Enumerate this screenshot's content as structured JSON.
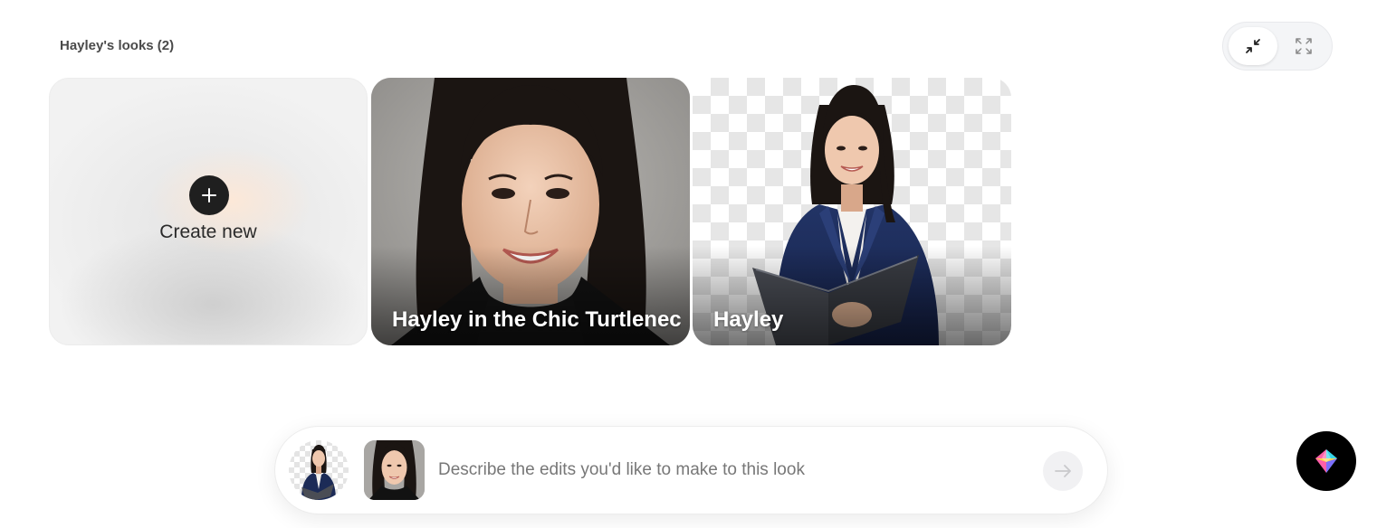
{
  "section": {
    "title": "Hayley's looks (2)"
  },
  "view_toggle": {
    "options": [
      {
        "icon": "collapse-icon",
        "active": true
      },
      {
        "icon": "expand-icon",
        "active": false
      }
    ]
  },
  "cards": [
    {
      "type": "create",
      "label": "Create new",
      "icon": "plus-icon"
    },
    {
      "type": "look",
      "label": "Hayley in the Chic Turtleneck",
      "image": "headshot-turtleneck"
    },
    {
      "type": "look",
      "label": "Hayley",
      "image": "blazer-folder-transparent-bg"
    }
  ],
  "prompt": {
    "placeholder": "Describe the edits you'd like to make to this look",
    "value": "",
    "thumbnails": [
      "hayley-blazer-thumb",
      "hayley-turtleneck-thumb"
    ],
    "send_icon": "arrow-right-icon"
  },
  "assistant": {
    "icon": "colorful-diamond-logo-icon"
  },
  "colors": {
    "accent_dark": "#1f1f1f",
    "blazer_navy": "#1c2b57",
    "turtleneck_black": "#141414",
    "logo_cyan": "#37d6e8",
    "logo_pink": "#ff5fa8",
    "logo_yellow": "#ffd34d",
    "logo_purple": "#8a5cff"
  }
}
